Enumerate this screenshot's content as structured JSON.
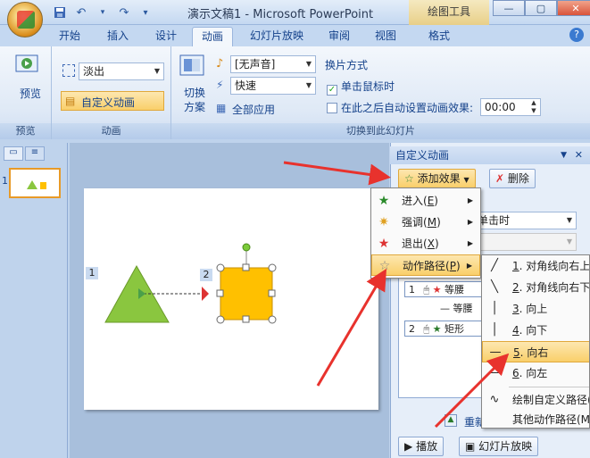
{
  "window": {
    "title": "演示文稿1 - Microsoft PowerPoint",
    "context_tab": "绘图工具",
    "min": "—",
    "max": "▢",
    "close": "✕"
  },
  "quick_access": {
    "save_icon": "save-icon",
    "undo": "↶",
    "redo": "↷",
    "more": "▾"
  },
  "tabs": [
    "开始",
    "插入",
    "设计",
    "动画",
    "幻灯片放映",
    "审阅",
    "视图",
    "格式"
  ],
  "active_tab": "动画",
  "help": "?",
  "ribbon": {
    "preview_group": {
      "button": "预览",
      "label": "预览"
    },
    "animation_group": {
      "effect_value": "淡出",
      "custom_button": "自定义动画",
      "label": "动画"
    },
    "transition_group": {
      "switch_scheme": "切换\n方案",
      "sound_value": "[无声音]",
      "speed_value": "快速",
      "apply_all": "全部应用",
      "advance_title": "换片方式",
      "on_click": "单击鼠标时",
      "auto_after": "在此之后自动设置动画效果:",
      "time_value": "00:00",
      "label": "切换到此幻灯片"
    }
  },
  "left_panel": {
    "slide_number": "1"
  },
  "slide": {
    "tag1": "1",
    "tag2": "2"
  },
  "pane": {
    "title": "自定义动画",
    "add_effect": "添加效果",
    "delete": "删除",
    "start_value": "单击时",
    "list": [
      {
        "num": "1",
        "text": "等腰"
      },
      {
        "num": "",
        "text": "等腰"
      },
      {
        "num": "2",
        "text": "矩形"
      }
    ],
    "reorder": "重新",
    "play": "播放",
    "slideshow": "幻灯片放映"
  },
  "menu": [
    {
      "label": "进入",
      "key": "E",
      "icon": "enter-star-icon"
    },
    {
      "label": "强调",
      "key": "M",
      "icon": "emphasis-star-icon"
    },
    {
      "label": "退出",
      "key": "X",
      "icon": "exit-star-icon"
    },
    {
      "label": "动作路径",
      "key": "P",
      "icon": "path-star-icon"
    }
  ],
  "submenu": [
    {
      "num": "1",
      "text": ". 对角线向右上"
    },
    {
      "num": "2",
      "text": ". 对角线向右下"
    },
    {
      "num": "3",
      "text": ". 向上"
    },
    {
      "num": "4",
      "text": ". 向下"
    },
    {
      "num": "5",
      "text": ". 向右"
    },
    {
      "num": "6",
      "text": ". 向左"
    },
    {
      "num": "",
      "text": "绘制自定义路径(D)"
    },
    {
      "num": "",
      "text": "其他动作路径(M)..."
    }
  ],
  "colors": {
    "arrow": "#e8322d",
    "triangle": "#8ac63f",
    "rect": "#ffc000"
  }
}
